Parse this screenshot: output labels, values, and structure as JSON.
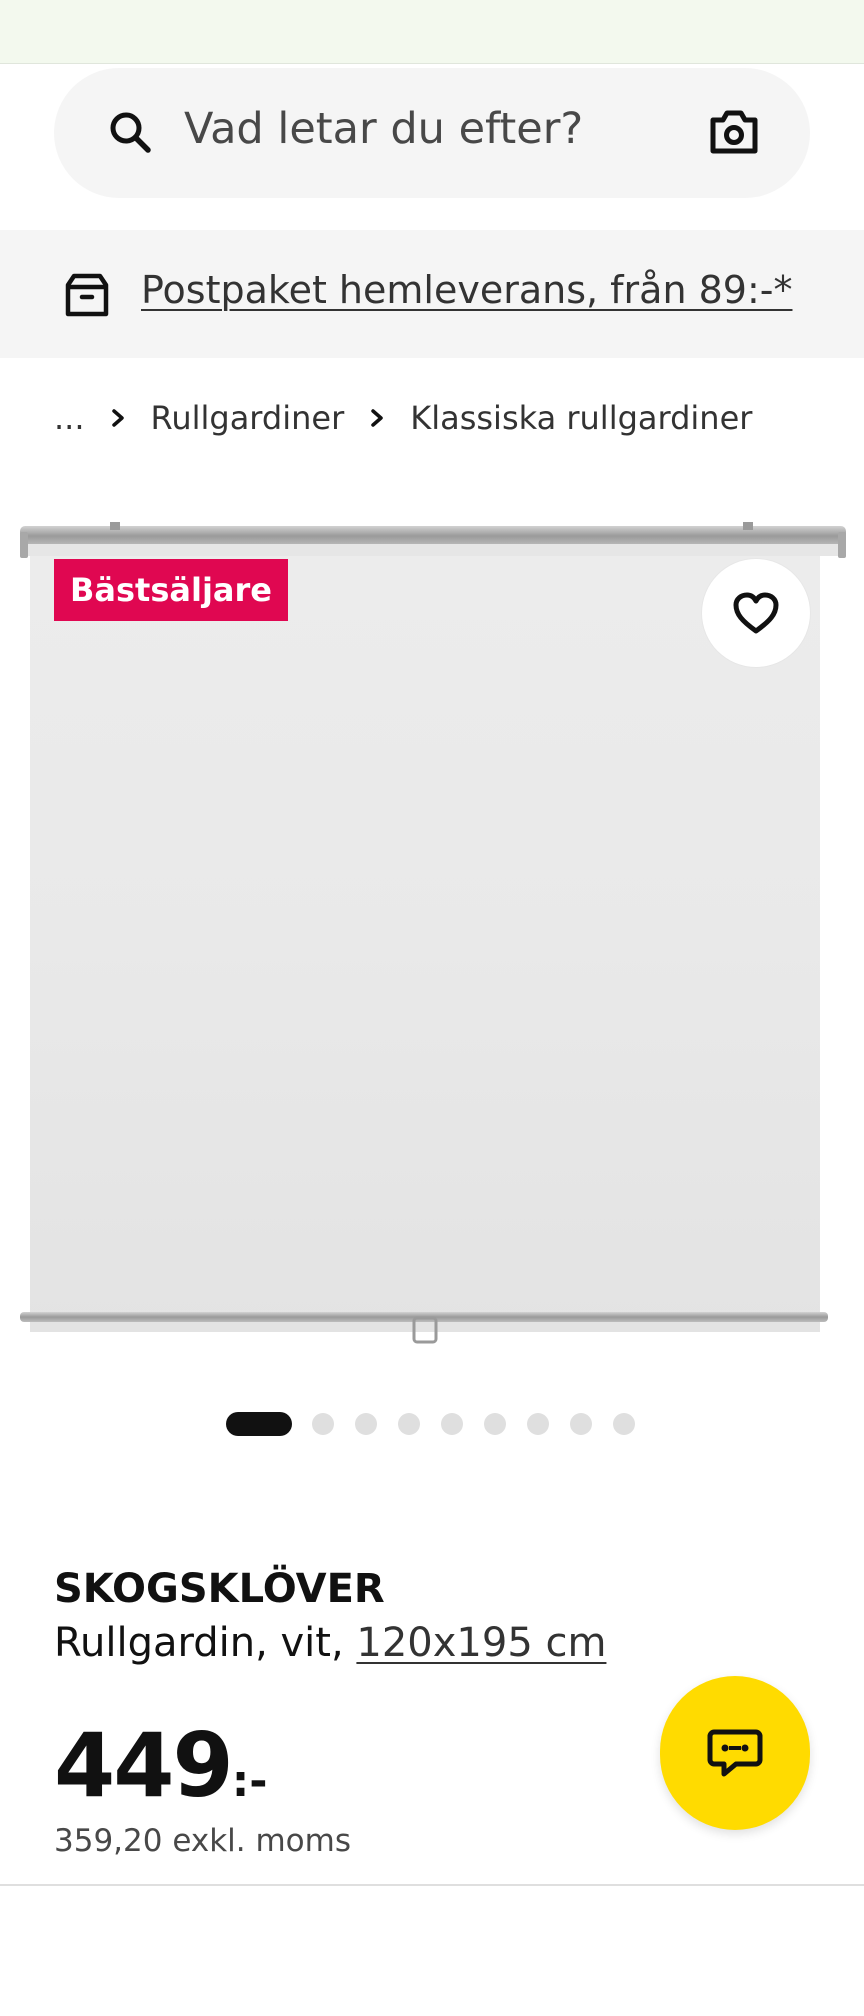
{
  "search": {
    "placeholder": "Vad letar du efter?"
  },
  "delivery_banner": {
    "text": "Postpaket hemleverans, från 89:-*"
  },
  "breadcrumb": {
    "items": [
      "...",
      "Rullgardiner",
      "Klassiska rullgardiner"
    ]
  },
  "product": {
    "badge": "Bästsäljare",
    "name": "SKOGSKLÖVER",
    "description": "Rullgardin, vit, ",
    "size": "120x195 cm",
    "price_integer": "449",
    "price_suffix": ":-",
    "price_excl_vat": "359,20 exkl. moms"
  },
  "gallery": {
    "image_count": 9,
    "active_index": 0
  },
  "icons": {
    "search": "search-icon",
    "camera": "camera-icon",
    "box": "box-icon",
    "heart": "heart-icon",
    "chat": "chat-icon",
    "chevron": "chevron-right-icon"
  },
  "colors": {
    "badge": "#e00751",
    "chat_button": "#ffdb00",
    "top_strip": "#f3f9ee"
  }
}
